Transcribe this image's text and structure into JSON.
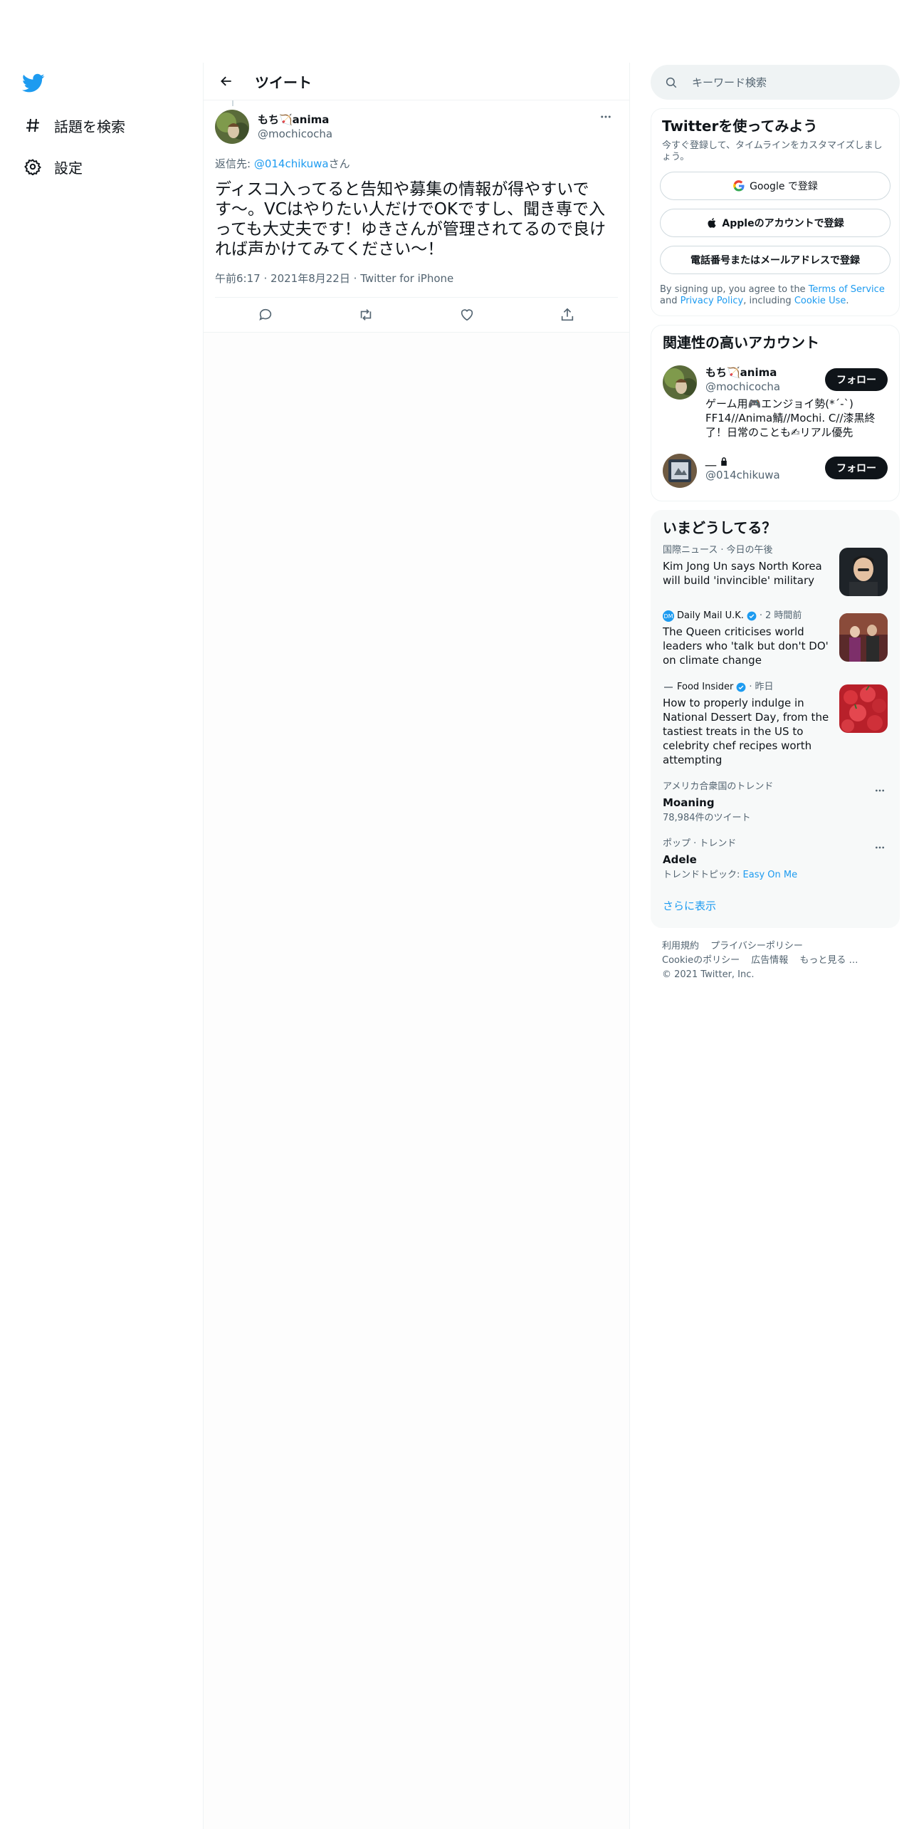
{
  "nav": {
    "explore_label": "話題を検索",
    "settings_label": "設定"
  },
  "header": {
    "title": "ツイート"
  },
  "tweet": {
    "author_name": "もち🏹anima",
    "author_handle": "@mochicocha",
    "reply_prefix": "返信先: ",
    "reply_target": "@014chikuwa",
    "reply_suffix": "さん",
    "text": "ディスコ入ってると告知や募集の情報が得やすいです〜。VCはやりたい人だけでOKですし、聞き専で入っても大丈夫です！ゆきさんが管理されてるので良ければ声かけてみてください〜！",
    "time": "午前6:17",
    "date": "2021年8月22日",
    "client": "Twitter for iPhone",
    "sep": "·"
  },
  "search": {
    "placeholder": "キーワード検索"
  },
  "signup": {
    "title": "Twitterを使ってみよう",
    "desc": "今すぐ登録して、タイムラインをカスタマイズしましょう。",
    "google_label": "Google で登録",
    "apple_label": "Appleのアカウントで登録",
    "email_label": "電話番号またはメールアドレスで登録",
    "terms_pre": "By signing up, you agree to the ",
    "terms_link": "Terms of Service",
    "terms_and": " and ",
    "privacy_link": "Privacy Policy",
    "terms_inc": ", including ",
    "cookie_link": "Cookie Use",
    "terms_end": "."
  },
  "related": {
    "title": "関連性の高いアカウント",
    "accounts": [
      {
        "name": "もち🏹anima",
        "handle": "@mochicocha",
        "bio": "ゲーム用🎮エンジョイ勢(*´-`) FF14//Anima鯖//Mochi. C//漆黒終了！日常のことも✍リアル優先",
        "follow": "フォロー"
      },
      {
        "name": "＿",
        "handle": "@014chikuwa",
        "bio": "",
        "follow": "フォロー"
      }
    ]
  },
  "trends": {
    "title": "いまどうしてる？",
    "news": [
      {
        "source": "国際ニュース",
        "sep": "·",
        "time": "今日の午後",
        "headline": "Kim Jong Un says North Korea will build 'invincible' military",
        "verified": false
      },
      {
        "source": "Daily Mail U.K.",
        "sep": "·",
        "time": "2 時間前",
        "headline": "The Queen criticises world leaders who 'talk but don't DO' on climate change",
        "verified": true
      },
      {
        "source": "Food Insider",
        "sep": "·",
        "time": "昨日",
        "headline": "How to properly indulge in National Dessert Day, from the tastiest treats in the US to celebrity chef recipes worth attempting",
        "verified": true
      }
    ],
    "items": [
      {
        "category": "アメリカ合衆国のトレンド",
        "name": "Moaning",
        "sub": "78,984件のツイート",
        "link": ""
      },
      {
        "category": "ポップ · トレンド",
        "name": "Adele",
        "sub": "トレンドトピック: ",
        "link": "Easy On Me"
      }
    ],
    "show_more": "さらに表示"
  },
  "footer": {
    "links": [
      "利用規約",
      "プライバシーポリシー",
      "Cookieのポリシー",
      "広告情報",
      "もっと見る …"
    ],
    "copyright": "© 2021 Twitter, Inc."
  },
  "colors": {
    "accent": "#1d9bf0",
    "text": "#0f1419",
    "muted": "#536471",
    "border": "#eff3f4"
  }
}
